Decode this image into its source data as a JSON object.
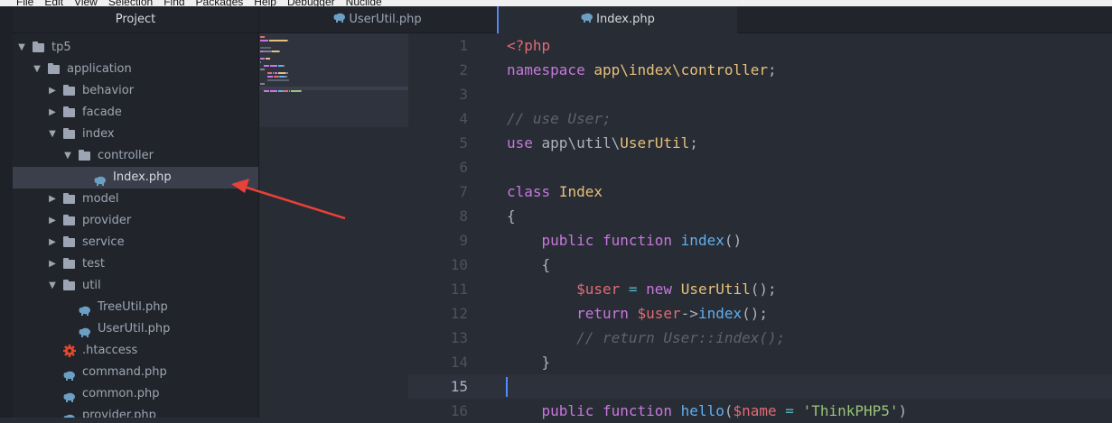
{
  "menu": [
    "File",
    "Edit",
    "View",
    "Selection",
    "Find",
    "Packages",
    "Help",
    "Debugger",
    "Nuclide"
  ],
  "sidebar": {
    "title": "Project",
    "tree": [
      {
        "label": "tp5",
        "type": "folder",
        "depth": 0,
        "expanded": true
      },
      {
        "label": "application",
        "type": "folder",
        "depth": 1,
        "expanded": true
      },
      {
        "label": "behavior",
        "type": "folder",
        "depth": 2,
        "expanded": false
      },
      {
        "label": "facade",
        "type": "folder",
        "depth": 2,
        "expanded": false
      },
      {
        "label": "index",
        "type": "folder",
        "depth": 2,
        "expanded": true
      },
      {
        "label": "controller",
        "type": "folder",
        "depth": 3,
        "expanded": true
      },
      {
        "label": "Index.php",
        "type": "php",
        "depth": 4,
        "selected": true
      },
      {
        "label": "model",
        "type": "folder",
        "depth": 2,
        "expanded": false
      },
      {
        "label": "provider",
        "type": "folder",
        "depth": 2,
        "expanded": false
      },
      {
        "label": "service",
        "type": "folder",
        "depth": 2,
        "expanded": false
      },
      {
        "label": "test",
        "type": "folder",
        "depth": 2,
        "expanded": false
      },
      {
        "label": "util",
        "type": "folder",
        "depth": 2,
        "expanded": true
      },
      {
        "label": "TreeUtil.php",
        "type": "php",
        "depth": 3
      },
      {
        "label": "UserUtil.php",
        "type": "php",
        "depth": 3
      },
      {
        "label": ".htaccess",
        "type": "config",
        "depth": 2
      },
      {
        "label": "command.php",
        "type": "php",
        "depth": 2
      },
      {
        "label": "common.php",
        "type": "php",
        "depth": 2
      },
      {
        "label": "provider.php",
        "type": "php",
        "depth": 2
      }
    ]
  },
  "tabs": [
    {
      "label": "UserUtil.php",
      "active": false
    },
    {
      "label": "Index.php",
      "active": true
    }
  ],
  "editor": {
    "current_line": 15,
    "lines": [
      {
        "n": "1",
        "tokens": [
          [
            "tag",
            "<?php"
          ]
        ]
      },
      {
        "n": "2",
        "tokens": [
          [
            "kw",
            "namespace"
          ],
          [
            "pl",
            " "
          ],
          [
            "ns",
            "app\\index\\controller"
          ],
          [
            "pl",
            ";"
          ]
        ]
      },
      {
        "n": "3",
        "tokens": []
      },
      {
        "n": "4",
        "tokens": [
          [
            "cmt",
            "// use User;"
          ]
        ]
      },
      {
        "n": "5",
        "tokens": [
          [
            "kw",
            "use"
          ],
          [
            "pl",
            " app\\util\\"
          ],
          [
            "cls",
            "UserUtil"
          ],
          [
            "pl",
            ";"
          ]
        ]
      },
      {
        "n": "6",
        "tokens": []
      },
      {
        "n": "7",
        "tokens": [
          [
            "kw",
            "class"
          ],
          [
            "pl",
            " "
          ],
          [
            "cls",
            "Index"
          ]
        ]
      },
      {
        "n": "8",
        "tokens": [
          [
            "pl",
            "{"
          ]
        ]
      },
      {
        "n": "9",
        "tokens": [
          [
            "pl",
            "    "
          ],
          [
            "kw",
            "public"
          ],
          [
            "pl",
            " "
          ],
          [
            "kw",
            "function"
          ],
          [
            "pl",
            " "
          ],
          [
            "fn",
            "index"
          ],
          [
            "pl",
            "()"
          ]
        ]
      },
      {
        "n": "10",
        "tokens": [
          [
            "pl",
            "    {"
          ]
        ]
      },
      {
        "n": "11",
        "tokens": [
          [
            "pl",
            "        "
          ],
          [
            "var",
            "$user"
          ],
          [
            "pl",
            " "
          ],
          [
            "op",
            "="
          ],
          [
            "pl",
            " "
          ],
          [
            "kw",
            "new"
          ],
          [
            "pl",
            " "
          ],
          [
            "cls",
            "UserUtil"
          ],
          [
            "pl",
            "();"
          ]
        ]
      },
      {
        "n": "12",
        "tokens": [
          [
            "pl",
            "        "
          ],
          [
            "kw",
            "return"
          ],
          [
            "pl",
            " "
          ],
          [
            "var",
            "$user"
          ],
          [
            "pl",
            "->"
          ],
          [
            "fn",
            "index"
          ],
          [
            "pl",
            "();"
          ]
        ]
      },
      {
        "n": "13",
        "tokens": [
          [
            "pl",
            "        "
          ],
          [
            "cmt",
            "// return User::index();"
          ]
        ]
      },
      {
        "n": "14",
        "tokens": [
          [
            "pl",
            "    }"
          ]
        ]
      },
      {
        "n": "15",
        "tokens": []
      },
      {
        "n": "16",
        "tokens": [
          [
            "pl",
            "    "
          ],
          [
            "kw",
            "public"
          ],
          [
            "pl",
            " "
          ],
          [
            "kw",
            "function"
          ],
          [
            "pl",
            " "
          ],
          [
            "fn",
            "hello"
          ],
          [
            "pl",
            "("
          ],
          [
            "var",
            "$name"
          ],
          [
            "pl",
            " "
          ],
          [
            "op",
            "="
          ],
          [
            "pl",
            " "
          ],
          [
            "str",
            "'ThinkPHP5'"
          ],
          [
            "pl",
            ")"
          ]
        ]
      }
    ]
  },
  "colors": {
    "accent": "#568af2",
    "annotation_arrow": "#e8413a",
    "php_icon": "#6b9fc4",
    "config_icon": "#e0492f"
  },
  "icons": {
    "folder": "folder-icon",
    "php": "php-elephant-icon",
    "config": "gear-icon",
    "expanded": "chevron-down-icon",
    "collapsed": "chevron-right-icon"
  }
}
